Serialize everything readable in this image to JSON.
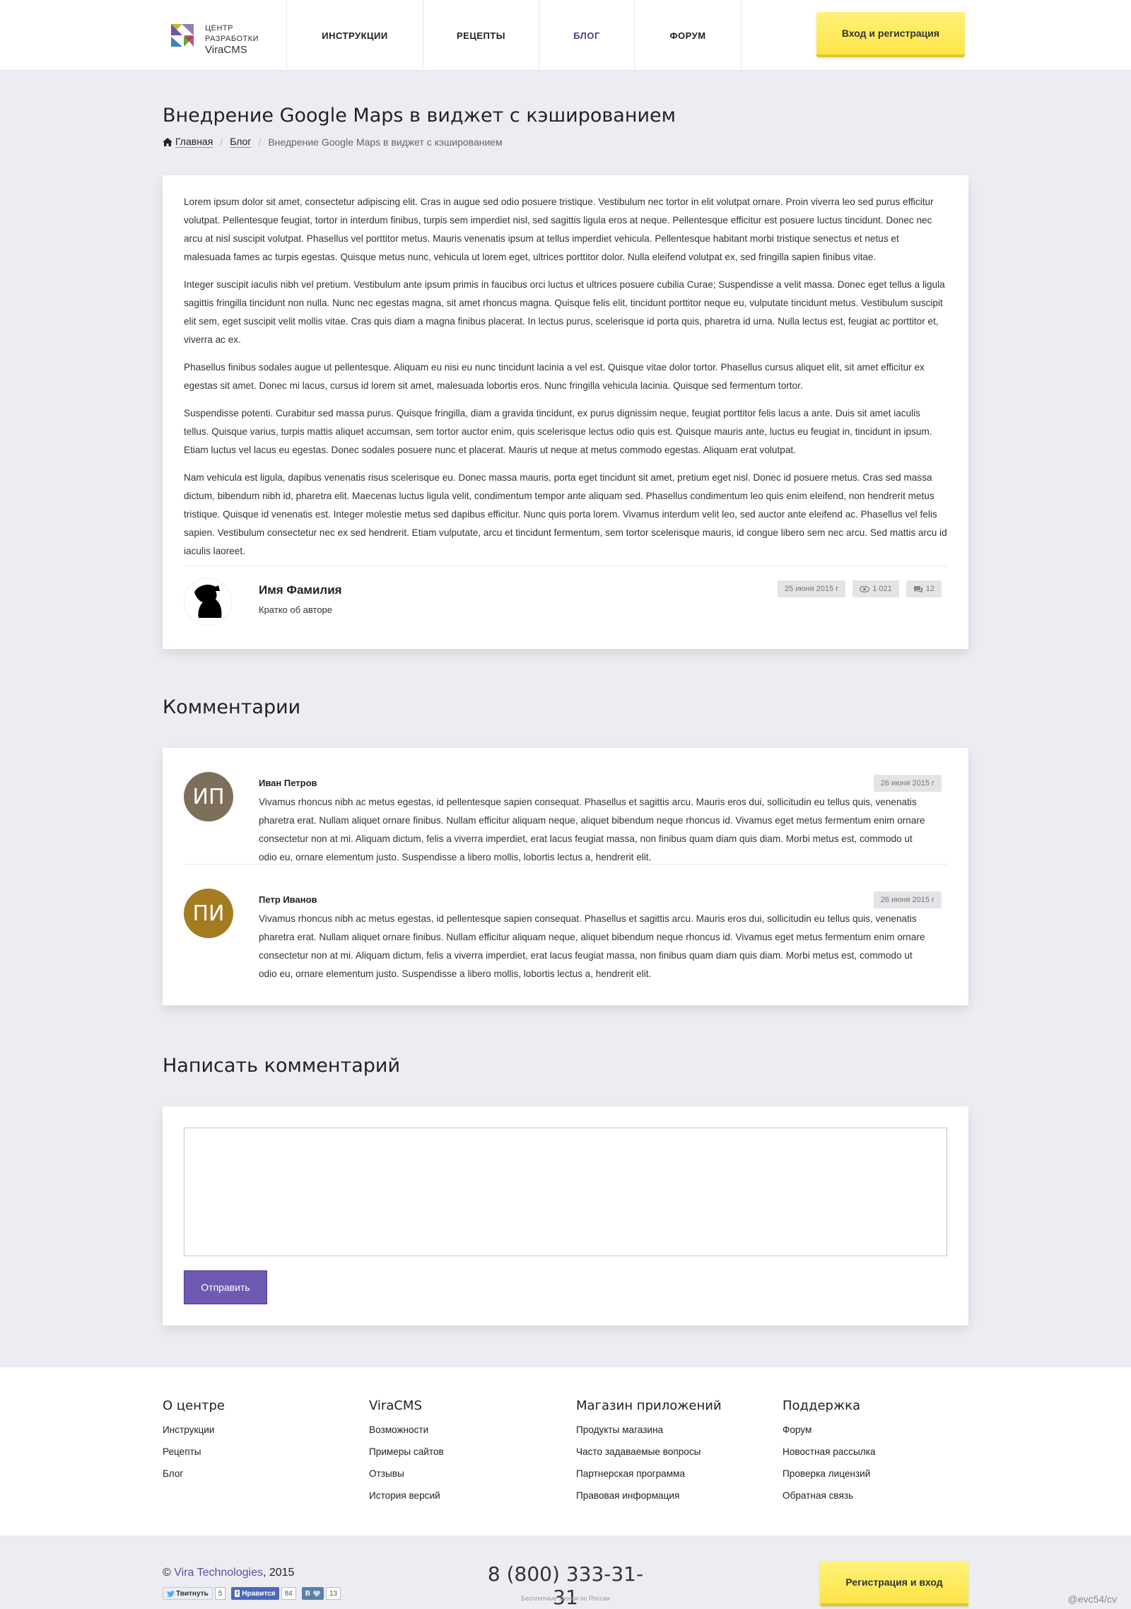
{
  "header": {
    "logo": {
      "line1": "ЦЕНТР",
      "line2": "РАЗРАБОТКИ",
      "line3": "ViraCMS"
    },
    "nav": [
      {
        "label": "ИНСТРУКЦИИ"
      },
      {
        "label": "РЕЦЕПТЫ"
      },
      {
        "label": "БЛОГ"
      },
      {
        "label": "ФОРУМ"
      }
    ],
    "login_label": "Вход и регистрация"
  },
  "page": {
    "title": "Внедрение Google Maps в виджет с кэшированием",
    "breadcrumb": {
      "home": "Главная",
      "blog": "Блог",
      "current": "Внедрение Google Maps в виджет с кэшированием"
    }
  },
  "article": {
    "paragraphs": [
      "Lorem ipsum dolor sit amet, consectetur adipiscing elit. Cras in augue sed odio posuere tristique. Vestibulum nec tortor in elit volutpat ornare. Proin viverra leo sed purus efficitur volutpat. Pellentesque feugiat, tortor in interdum finibus, turpis sem imperdiet nisl, sed sagittis ligula eros at neque. Pellentesque efficitur est posuere luctus tincidunt. Donec nec arcu at nisl suscipit volutpat. Phasellus vel porttitor metus. Mauris venenatis ipsum at tellus imperdiet vehicula. Pellentesque habitant morbi tristique senectus et netus et malesuada fames ac turpis egestas. Quisque metus nunc, vehicula ut lorem eget, ultrices porttitor dolor. Nulla eleifend volutpat ex, sed fringilla sapien finibus vitae.",
      "Integer suscipit iaculis nibh vel pretium. Vestibulum ante ipsum primis in faucibus orci luctus et ultrices posuere cubilia Curae; Suspendisse a velit massa. Donec eget tellus a ligula sagittis fringilla tincidunt non nulla. Nunc nec egestas magna, sit amet rhoncus magna. Quisque felis elit, tincidunt porttitor neque eu, vulputate tincidunt metus. Vestibulum suscipit elit sem, eget suscipit velit mollis vitae. Cras quis diam a magna finibus placerat. In lectus purus, scelerisque id porta quis, pharetra id urna. Nulla lectus est, feugiat ac porttitor et, viverra ac ex.",
      "Phasellus finibus sodales augue ut pellentesque. Aliquam eu nisi eu nunc tincidunt lacinia a vel est. Quisque vitae dolor tortor. Phasellus cursus aliquet elit, sit amet efficitur ex egestas sit amet. Donec mi lacus, cursus id lorem sit amet, malesuada lobortis eros. Nunc fringilla vehicula lacinia. Quisque sed fermentum tortor.",
      "Suspendisse potenti. Curabitur sed massa purus. Quisque fringilla, diam a gravida tincidunt, ex purus dignissim neque, feugiat porttitor felis lacus a ante. Duis sit amet iaculis tellus. Quisque varius, turpis mattis aliquet accumsan, sem tortor auctor enim, quis scelerisque lectus odio quis est. Quisque mauris ante, luctus eu feugiat in, tincidunt in ipsum. Etiam luctus vel lacus eu egestas. Donec sodales posuere nunc et placerat. Mauris ut neque at metus commodo egestas. Aliquam erat volutpat.",
      "Nam vehicula est ligula, dapibus venenatis risus scelerisque eu. Donec massa mauris, porta eget tincidunt sit amet, pretium eget nisl. Donec id posuere metus. Cras sed massa dictum, bibendum nibh id, pharetra elit. Maecenas luctus ligula velit, condimentum tempor ante aliquam sed. Phasellus condimentum leo quis enim eleifend, non hendrerit metus tristique. Quisque id venenatis est. Integer molestie metus sed dapibus efficitur. Nunc quis porta lorem. Vivamus interdum velit leo, sed auctor ante eleifend ac. Phasellus vel felis sapien. Vestibulum consectetur nec ex sed hendrerit. Etiam vulputate, arcu et tincidunt fermentum, sem tortor scelerisque mauris, id congue libero sem nec arcu. Sed mattis arcu id iaculis laoreet."
    ],
    "author": {
      "name": "Имя Фамилия",
      "about": "Кратко об авторе"
    },
    "meta": {
      "date": "25 июня 2015 г",
      "views": "1 021",
      "comments": "12"
    }
  },
  "comments": {
    "title": "Комментарии",
    "items": [
      {
        "initials": "ИП",
        "color": "#7d6f5a",
        "name": "Иван Петров",
        "date": "26 июня 2015 г",
        "text": "Vivamus rhoncus nibh ac metus egestas, id pellentesque sapien consequat. Phasellus et sagittis arcu. Mauris eros dui, sollicitudin eu tellus quis, venenatis pharetra erat. Nullam aliquet ornare finibus. Nullam efficitur aliquam neque, aliquet bibendum neque rhoncus id. Vivamus eget metus fermentum enim ornare consectetur non at mi. Aliquam dictum, felis a viverra imperdiet, erat lacus feugiat massa, non finibus quam diam quis diam. Morbi metus est, commodo ut odio eu, ornare elementum justo. Suspendisse a libero mollis, lobortis lectus a, hendrerit elit."
      },
      {
        "initials": "ПИ",
        "color": "#a37c22",
        "name": "Петр Иванов",
        "date": "26 июня 2015 г",
        "text": "Vivamus rhoncus nibh ac metus egestas, id pellentesque sapien consequat. Phasellus et sagittis arcu. Mauris eros dui, sollicitudin eu tellus quis, venenatis pharetra erat. Nullam aliquet ornare finibus. Nullam efficitur aliquam neque, aliquet bibendum neque rhoncus id. Vivamus eget metus fermentum enim ornare consectetur non at mi. Aliquam dictum, felis a viverra imperdiet, erat lacus feugiat massa, non finibus quam diam quis diam. Morbi metus est, commodo ut odio eu, ornare elementum justo. Suspendisse a libero mollis, lobortis lectus a, hendrerit elit."
      }
    ]
  },
  "form": {
    "title": "Написать комментарий",
    "textarea_value": "",
    "submit_label": "Отправить"
  },
  "footer": {
    "columns": [
      {
        "title": "О центре",
        "links": [
          "Инструкции",
          "Рецепты",
          "Блог"
        ]
      },
      {
        "title": "ViraCMS",
        "links": [
          "Возможности",
          "Примеры сайтов",
          "Отзывы",
          "История версий"
        ]
      },
      {
        "title": "Магазин приложений",
        "links": [
          "Продукты магазина",
          "Часто задаваемые вопросы",
          "Партнерская программа",
          "Правовая информация"
        ]
      },
      {
        "title": "Поддержка",
        "links": [
          "Форум",
          "Новостная рассылка",
          "Проверка лицензий",
          "Обратная связь"
        ]
      }
    ],
    "copyright_symbol": "©",
    "brand": "Vira Technologies",
    "year": ", 2015",
    "social": {
      "twitter_label": "Твитнуть",
      "twitter_count": "5",
      "fb_label": "Нравится",
      "fb_count": "84",
      "vk_label": "В",
      "vk_count": "13"
    },
    "phone": "8 (800) 333-31-31",
    "phone_note": "Бесплатные звонки по России",
    "register_label": "Регистрация и вход",
    "signature": "@evc54/cv"
  },
  "colors": {
    "accent": "#6f5ab3",
    "button_yellow": "#fde447",
    "nav_active": "#4b3f8d",
    "brand_link": "#5f4f9f"
  }
}
